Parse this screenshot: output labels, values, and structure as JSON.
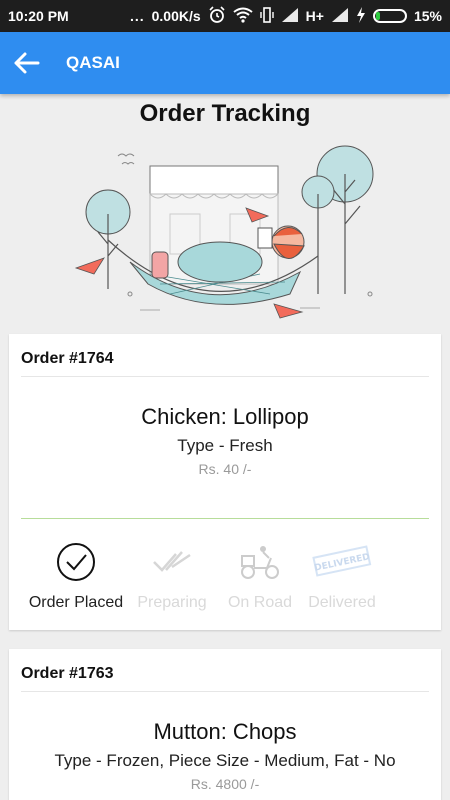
{
  "status_bar": {
    "time": "10:20 PM",
    "dots": "...",
    "network_speed": "0.00K/s",
    "network_type": "H+",
    "battery_percent": "15%",
    "icons": [
      "alarm-icon",
      "wifi-icon",
      "vibrate-icon",
      "signal-icon",
      "charging-icon",
      "battery-icon"
    ]
  },
  "app_bar": {
    "title": "QASAI",
    "back_icon": "back-arrow-icon",
    "color": "#2f8df0"
  },
  "page": {
    "title": "Order Tracking",
    "illustration": "man-in-hammock-illustration"
  },
  "orders": [
    {
      "order_no": "Order #1764",
      "item_name": "Chicken: Lollipop",
      "item_type": "Type - Fresh",
      "price": "Rs. 40 /-",
      "steps": [
        {
          "label": "Order Placed",
          "icon": "check-circle-icon",
          "active": true
        },
        {
          "label": "Preparing",
          "icon": "double-check-icon",
          "active": false
        },
        {
          "label": "On Road",
          "icon": "delivery-scooter-icon",
          "active": false
        },
        {
          "label": "Delivered",
          "icon": "delivered-stamp-icon",
          "stamp_text": "DELIVERED",
          "active": false
        }
      ]
    },
    {
      "order_no": "Order #1763",
      "item_name": "Mutton: Chops",
      "item_type": "Type - Frozen, Piece Size - Medium, Fat - No",
      "price": "Rs. 4800 /-"
    }
  ],
  "colors": {
    "accent": "#2f8df0",
    "divider_green": "#b7dd9a",
    "inactive_text": "#d9d9d9"
  }
}
